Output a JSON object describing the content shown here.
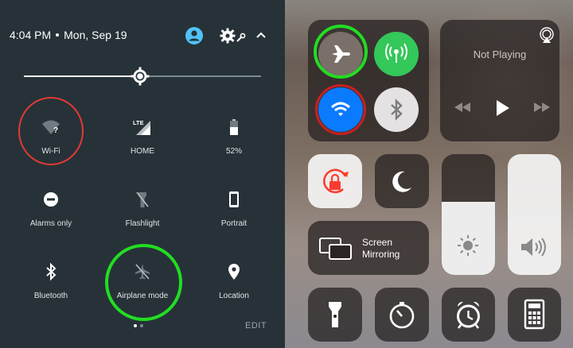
{
  "android": {
    "status": {
      "time": "4:04 PM",
      "date": "Mon, Sep 19"
    },
    "brightness_level": 0.49,
    "tiles": [
      {
        "id": "wifi",
        "label": "Wi-Fi",
        "icon": "wifi-unknown-icon"
      },
      {
        "id": "network",
        "label": "HOME",
        "icon": "lte-signal-icon"
      },
      {
        "id": "battery",
        "label": "52%",
        "icon": "battery-icon"
      },
      {
        "id": "dnd",
        "label": "Alarms only",
        "icon": "do-not-disturb-icon"
      },
      {
        "id": "flashlight",
        "label": "Flashlight",
        "icon": "flashlight-icon"
      },
      {
        "id": "rotation",
        "label": "Portrait",
        "icon": "phone-portrait-icon"
      },
      {
        "id": "bluetooth",
        "label": "Bluetooth",
        "icon": "bluetooth-icon"
      },
      {
        "id": "airplane",
        "label": "Airplane mode",
        "icon": "airplane-icon"
      },
      {
        "id": "location",
        "label": "Location",
        "icon": "location-pin-icon"
      }
    ],
    "edit_label": "EDIT",
    "pages": 2,
    "current_page": 1
  },
  "ios": {
    "now_playing": "Not Playing",
    "screen_mirroring": [
      "Screen",
      "Mirroring"
    ],
    "colors": {
      "cellular_green": "#34c759",
      "wifi_blue": "#0a7aff",
      "rotation_red": "#ff3b30"
    }
  },
  "annotations": {
    "highlight_red": "#e53935",
    "highlight_green": "#22dd22"
  }
}
